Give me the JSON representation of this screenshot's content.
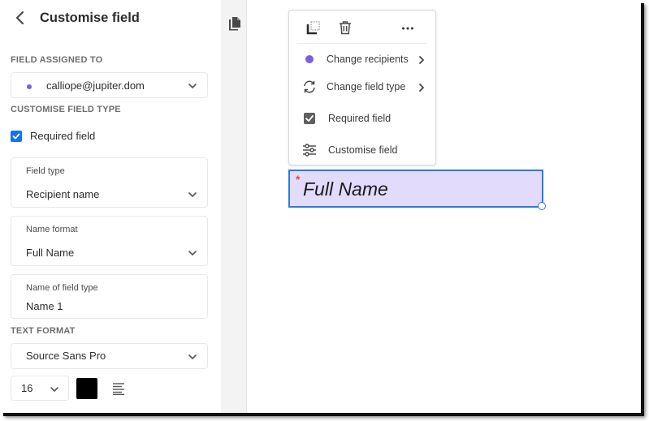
{
  "sidebar": {
    "title": "Customise field",
    "field_assigned_label": "FIELD ASSIGNED TO",
    "assignee": {
      "email": "calliope@jupiter.dom",
      "color": "#7b5de6"
    },
    "customise_type_label": "CUSTOMISE FIELD TYPE",
    "required": {
      "label": "Required field",
      "checked": true
    },
    "field_type": {
      "label": "Field type",
      "value": "Recipient name"
    },
    "name_format": {
      "label": "Name format",
      "value": "Full Name"
    },
    "name_of_field": {
      "label": "Name of field type",
      "value": "Name 1"
    },
    "text_format_label": "TEXT FORMAT",
    "font": {
      "value": "Source Sans Pro"
    },
    "font_size": {
      "value": "16"
    },
    "text_color": "#000000",
    "alignment": "left"
  },
  "strip": {
    "icon": "document-pages-icon"
  },
  "popover": {
    "tools": [
      "duplicate-icon",
      "delete-icon",
      "more-icon"
    ],
    "items": [
      {
        "label": "Change recipients",
        "icon": "recipient-dot-icon",
        "submenu": true,
        "color": "#7b5de6"
      },
      {
        "label": "Change field type",
        "icon": "refresh-icon",
        "submenu": true
      },
      {
        "label": "Required field",
        "icon": "checkbox-icon",
        "submenu": false,
        "checked": true
      },
      {
        "label": "Customise field",
        "icon": "sliders-icon",
        "submenu": false
      }
    ]
  },
  "form_field": {
    "placeholder": "Full Name",
    "required_marker": "*",
    "fill_color": "#e2dbfc",
    "border_color": "#2b7bd9"
  }
}
